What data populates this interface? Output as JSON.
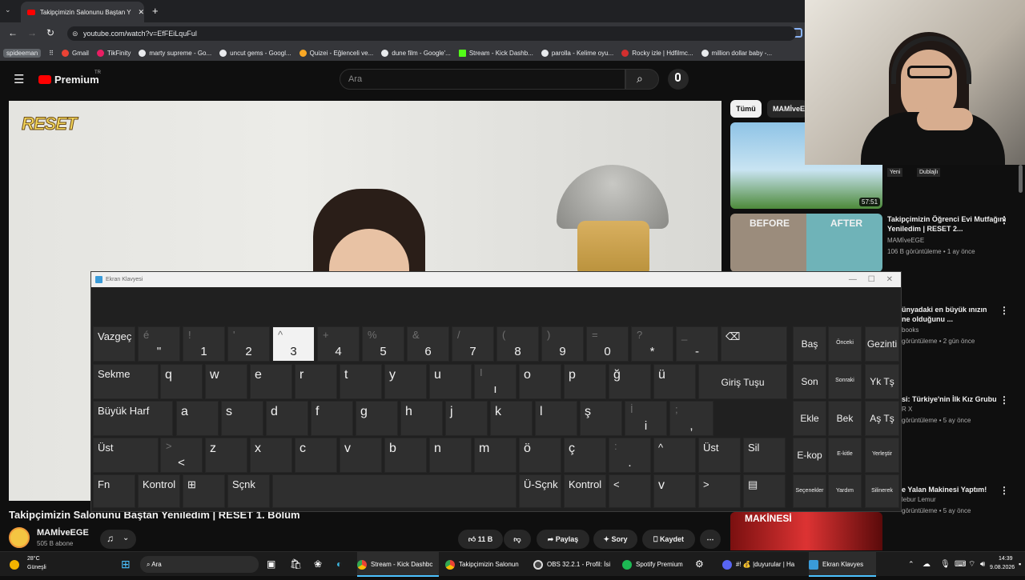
{
  "browser": {
    "tab_title": "Takipçimizin Salonunu Baştan Y",
    "new_tab": "+",
    "url": "youtube.com/watch?v=EfFEiLquFul",
    "profile": "spideeman",
    "bookmarks": [
      "Gmail",
      "TikFinity",
      "marty supreme - Go...",
      "uncut gems - Googl...",
      "Quizei - Eğlenceli ve...",
      "dune film - Google'...",
      "Stream - Kick Dashb...",
      "parolla - Kelime oyu...",
      "Rocky izle | Hdfilmc...",
      "million dollar baby -..."
    ]
  },
  "youtube": {
    "brand": "Premium",
    "brand_sup": "TR",
    "search_placeholder": "Ara",
    "chips": [
      "Tümü",
      "MAMİveE"
    ],
    "video_logo": "RESET",
    "video_title": "Takipçimizin Salonunu Baştan Yeniledim | RESET 1. Bölüm",
    "channel": "MAMİveEGE",
    "subscribers": "505 B abone",
    "likes": "11 B",
    "actions": [
      "Paylaş",
      "Sorу",
      "Kaydet"
    ],
    "side": [
      {
        "time": "57:51",
        "badges": [
          "Yeni",
          "Dublajlı"
        ]
      },
      {
        "title": "Takipçimizin Öğrenci Evi Mutfağını Yeniledim | RESET 2...",
        "channel": "MAMİveEGE",
        "meta": "106 B görüntüleme • 1 ay önce",
        "before": "BEFORE",
        "after": "AFTER"
      },
      {
        "title": "ünyadaki en büyük ınızın ne olduğunu ...",
        "channel": "books",
        "meta": "görüntüleme • 2 gün önce"
      },
      {
        "title": "si: Türkiye'nin İlk Kız Grubu",
        "channel": "R X",
        "meta": "görüntüleme • 5 ay önce"
      },
      {
        "title": "e Yalan Makinesi Yaptım!",
        "channel": "lebur Lemur",
        "meta": "görüntüleme • 5 ay önce",
        "thumb_text": "MAKİNESİ"
      }
    ]
  },
  "keyboard": {
    "title": "Ekran Klavyesi",
    "rows": [
      [
        {
          "t": "Vazgeç"
        },
        {
          "u": "é",
          "l": "\""
        },
        {
          "u": "!",
          "l": "1"
        },
        {
          "u": "'",
          "l": "2"
        },
        {
          "u": "^",
          "l": "3",
          "hover": true
        },
        {
          "u": "+",
          "l": "4"
        },
        {
          "u": "%",
          "l": "5"
        },
        {
          "u": "&",
          "l": "6"
        },
        {
          "u": "/",
          "l": "7"
        },
        {
          "u": "(",
          "l": "8"
        },
        {
          "u": ")",
          "l": "9"
        },
        {
          "u": "=",
          "l": "0"
        },
        {
          "u": "?",
          "l": "*"
        },
        {
          "u": "_",
          "l": "-"
        },
        {
          "t": "⌫"
        },
        {
          "t": "Baş"
        },
        {
          "t": "Önceki"
        },
        {
          "t": "Gezinti"
        }
      ],
      [
        {
          "t": "Sekme"
        },
        {
          "t": "q"
        },
        {
          "t": "w"
        },
        {
          "t": "e"
        },
        {
          "t": "r"
        },
        {
          "t": "t"
        },
        {
          "t": "y"
        },
        {
          "t": "u"
        },
        {
          "u": "I",
          "l": "ı"
        },
        {
          "t": "o"
        },
        {
          "t": "p"
        },
        {
          "t": "ğ"
        },
        {
          "t": "ü"
        },
        {
          "t": "Giriş Tuşu"
        },
        {
          "t": "Son"
        },
        {
          "t": "Sonraki"
        },
        {
          "t": "Yk Tş"
        }
      ],
      [
        {
          "t": "Büyük Harf"
        },
        {
          "t": "a"
        },
        {
          "t": "s"
        },
        {
          "t": "d"
        },
        {
          "t": "f"
        },
        {
          "t": "g"
        },
        {
          "t": "h"
        },
        {
          "t": "j"
        },
        {
          "t": "k"
        },
        {
          "t": "l"
        },
        {
          "t": "ş"
        },
        {
          "u": "İ",
          "l": "i"
        },
        {
          "u": ";",
          "l": ","
        },
        {
          "t": "Ekle"
        },
        {
          "t": "Bek"
        },
        {
          "t": "Aş Tş"
        }
      ],
      [
        {
          "t": "Üst"
        },
        {
          "u": ">",
          "l": "<"
        },
        {
          "t": "z"
        },
        {
          "t": "x"
        },
        {
          "t": "c"
        },
        {
          "t": "v"
        },
        {
          "t": "b"
        },
        {
          "t": "n"
        },
        {
          "t": "m"
        },
        {
          "t": "ö"
        },
        {
          "t": "ç"
        },
        {
          "u": ":",
          "l": "."
        },
        {
          "t": "^"
        },
        {
          "t": "Üst"
        },
        {
          "t": "Sil"
        },
        {
          "t": "E-kop"
        },
        {
          "t": "E-kitle"
        },
        {
          "t": "Yerleştir"
        }
      ],
      [
        {
          "t": "Fn"
        },
        {
          "t": "Kontrol"
        },
        {
          "t": "⊞"
        },
        {
          "t": "Sçnk"
        },
        {
          "t": ""
        },
        {
          "t": "Ü-Sçnk"
        },
        {
          "t": "Kontrol"
        },
        {
          "t": "<"
        },
        {
          "t": "v"
        },
        {
          "t": ">"
        },
        {
          "t": "▤"
        },
        {
          "t": "Seçenekler"
        },
        {
          "t": "Yardım"
        },
        {
          "t": "Silinerek"
        }
      ]
    ]
  },
  "taskbar": {
    "weather_temp": "28°C",
    "weather_desc": "Güneşli",
    "search": "Ara",
    "apps": [
      "Stream - Kick Dashbc",
      "Takipçimizin Salonun",
      "OBS 32.2.1 - Profil: İsi",
      "Spotify Premium",
      "#! 💰 |duyurular | Ha",
      "Ekran Klavyes"
    ],
    "time": "14:39",
    "date": "9.08.2026"
  }
}
